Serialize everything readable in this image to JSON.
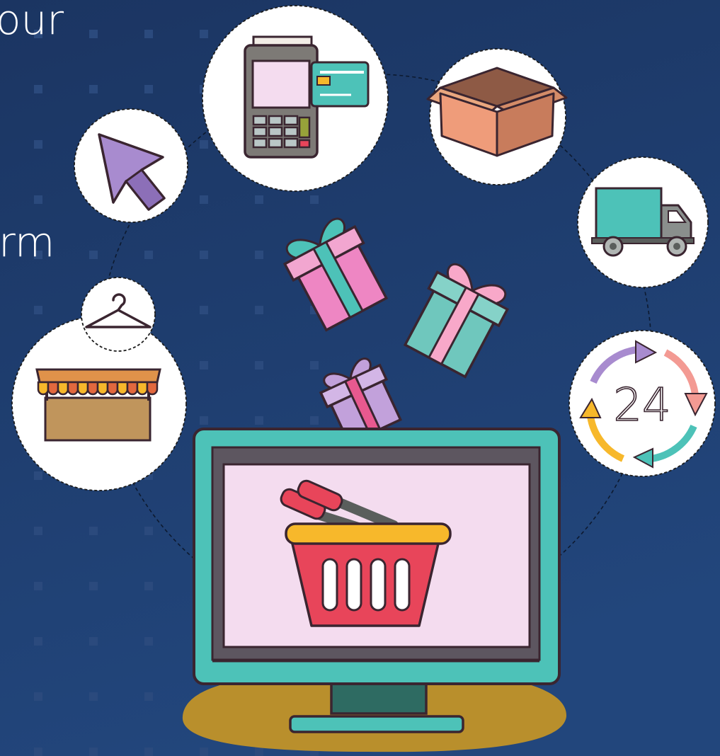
{
  "background": {
    "colors": [
      "#1b3562",
      "#22467c"
    ],
    "dot_color": "#2b4a7d"
  },
  "headline_fragments": {
    "line1": "our",
    "line2": "rm",
    "text_color": "#ffffff"
  },
  "illustration": {
    "subject": "online shopping",
    "ring_icons": [
      "arrow-cursor-icon",
      "card-payment-terminal-icon",
      "open-box-icon",
      "delivery-truck-icon",
      "24-hour-cycle-icon",
      "market-stall-icon",
      "clothes-hanger-icon"
    ],
    "clock_label": "24",
    "monitor_screen_icon": "shopping-basket-icon",
    "gift_icons": [
      "pink-gift-icon",
      "teal-gift-icon",
      "purple-gift-icon"
    ],
    "palette": {
      "teal": "#4dc2b8",
      "dark_outline": "#3a2530",
      "screen_pink": "#f4dcef",
      "basket_red": "#e8455a",
      "basket_rim": "#f7b82b",
      "puddle": "#b98f2c"
    }
  }
}
